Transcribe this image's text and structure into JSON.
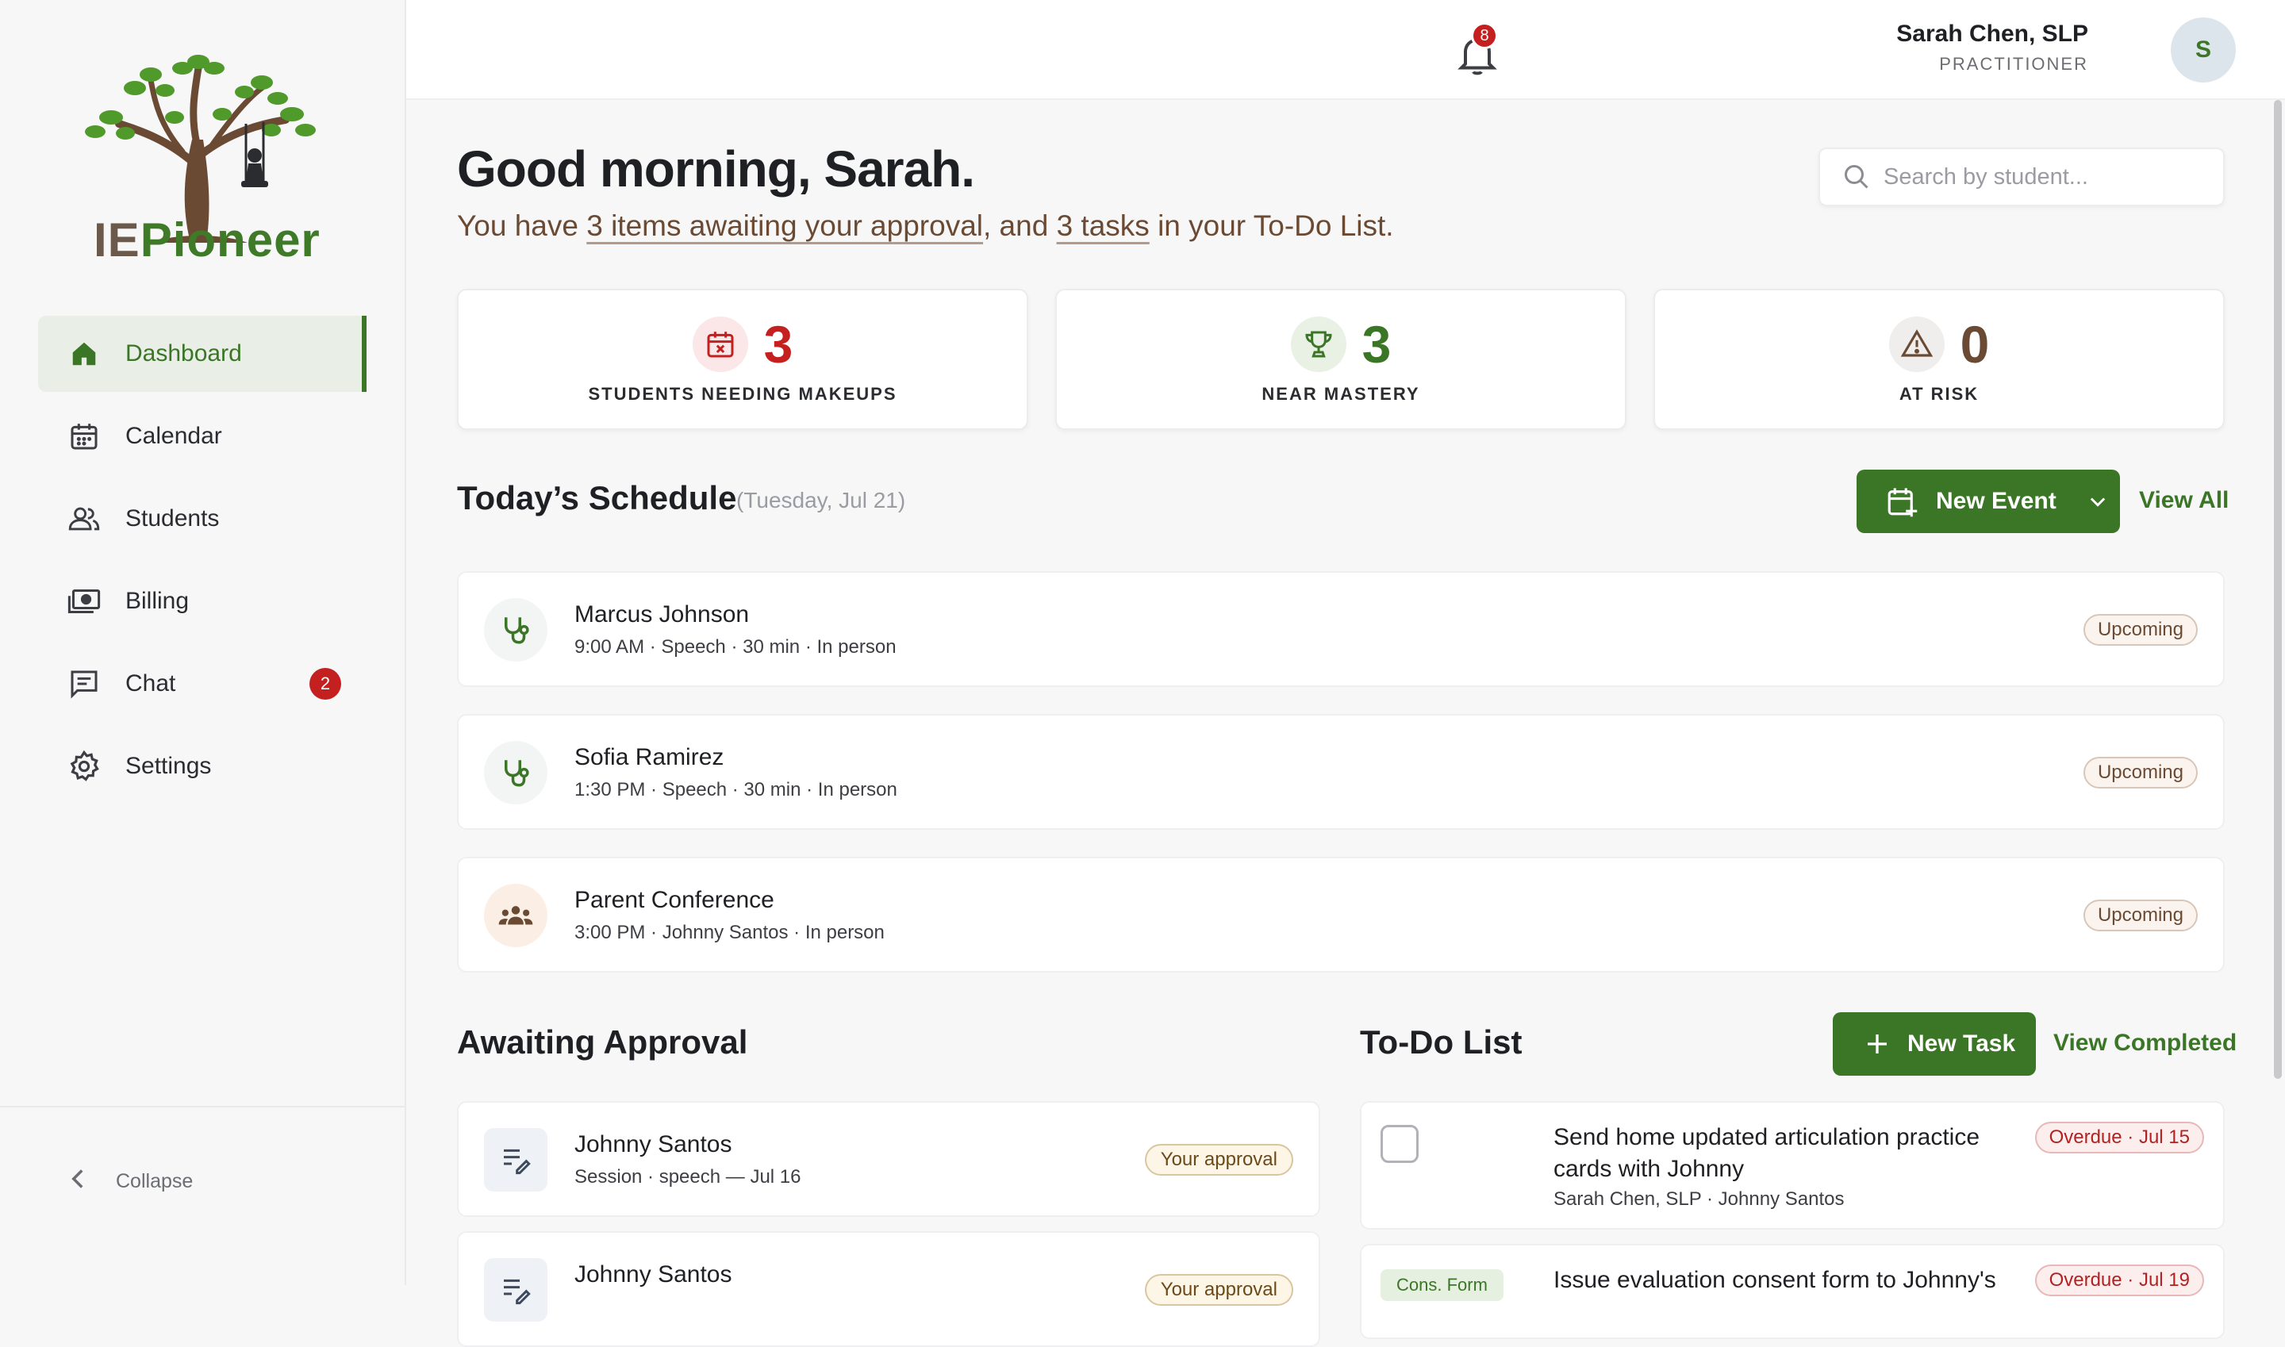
{
  "brand": {
    "ie": "IE",
    "pioneer": "Pioneer"
  },
  "nav": [
    {
      "label": "Dashboard"
    },
    {
      "label": "Calendar"
    },
    {
      "label": "Students"
    },
    {
      "label": "Billing"
    },
    {
      "label": "Chat",
      "badge": "2"
    },
    {
      "label": "Settings"
    }
  ],
  "sidebar": {
    "collapse_label": "Collapse"
  },
  "topbar": {
    "notification_count": "8",
    "user_name": "Sarah Chen, SLP",
    "user_role": "PRACTITIONER",
    "avatar_initial": "S"
  },
  "greeting": {
    "title": "Good morning, Sarah.",
    "line_pre": "You have ",
    "approval_link": "3 items awaiting your approval",
    "line_mid": ", and ",
    "tasks_link": "3 tasks",
    "line_post": " in your To-Do List."
  },
  "search": {
    "placeholder": "Search by student..."
  },
  "stats": [
    {
      "value": "3",
      "label": "STUDENTS NEEDING MAKEUPS",
      "color": "#c4201f"
    },
    {
      "value": "3",
      "label": "NEAR MASTERY",
      "color": "#3b7627"
    },
    {
      "value": "0",
      "label": "AT RISK",
      "color": "#6b4a34"
    }
  ],
  "schedule": {
    "title": "Today’s Schedule",
    "date": "(Tuesday, Jul 21)",
    "new_event_label": "New Event",
    "view_all_label": "View All",
    "events": [
      {
        "name": "Marcus Johnson",
        "details": "9:00 AM · Speech · 30 min · In person",
        "status": "Upcoming"
      },
      {
        "name": "Sofia Ramirez",
        "details": "1:30 PM · Speech · 30 min · In person",
        "status": "Upcoming"
      },
      {
        "name": "Parent Conference",
        "details": "3:00 PM · Johnny Santos · In person",
        "status": "Upcoming"
      }
    ]
  },
  "approval": {
    "title": "Awaiting Approval",
    "items": [
      {
        "name": "Johnny Santos",
        "details": "Session · speech — Jul 16",
        "status": "Your approval"
      },
      {
        "name": "Johnny Santos",
        "details": "",
        "status": "Your approval"
      }
    ]
  },
  "todo": {
    "title": "To-Do List",
    "new_task_label": "New Task",
    "view_completed_label": "View Completed",
    "items": [
      {
        "title": "Send home updated articulation practice cards with Johnny",
        "meta": "Sarah Chen, SLP · Johnny Santos",
        "status": "Overdue · Jul 15"
      },
      {
        "title": "Issue evaluation consent form to Johnny's",
        "meta": "",
        "tag": "Cons. Form",
        "status": "Overdue · Jul 19"
      }
    ]
  }
}
